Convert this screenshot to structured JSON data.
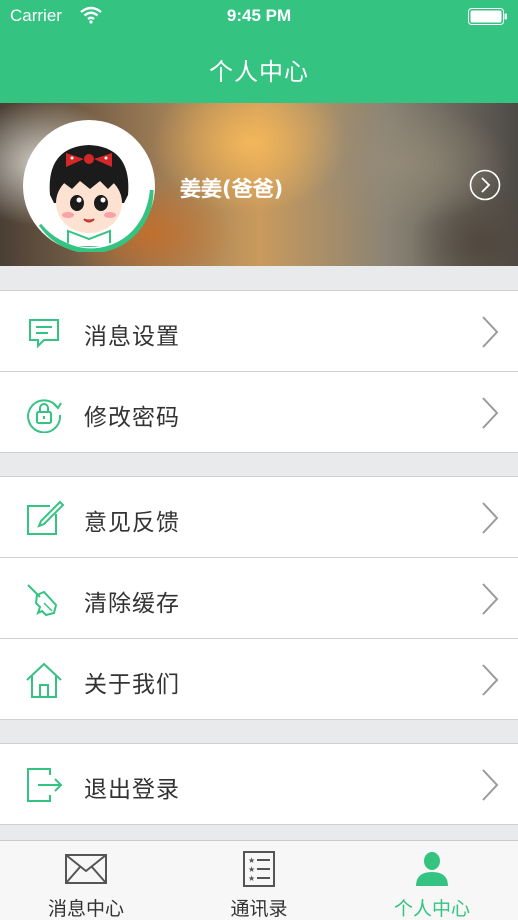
{
  "status_bar": {
    "carrier": "Carrier",
    "time": "9:45 PM"
  },
  "header": {
    "title": "个人中心"
  },
  "profile": {
    "name": "姜姜(爸爸)"
  },
  "menu": {
    "group1": [
      {
        "label": "消息设置",
        "icon": "chat-bubble-icon"
      },
      {
        "label": "修改密码",
        "icon": "lock-refresh-icon"
      }
    ],
    "group2": [
      {
        "label": "意见反馈",
        "icon": "edit-icon"
      },
      {
        "label": "清除缓存",
        "icon": "broom-icon"
      },
      {
        "label": "关于我们",
        "icon": "home-icon"
      }
    ],
    "group3": [
      {
        "label": "退出登录",
        "icon": "logout-icon"
      }
    ]
  },
  "tabbar": {
    "tabs": [
      {
        "label": "消息中心",
        "icon": "envelope-icon",
        "active": false
      },
      {
        "label": "通讯录",
        "icon": "contacts-list-icon",
        "active": false
      },
      {
        "label": "个人中心",
        "icon": "person-icon",
        "active": true
      }
    ]
  },
  "colors": {
    "accent": "#35c382",
    "background": "#e9eaec",
    "text": "#333333"
  }
}
